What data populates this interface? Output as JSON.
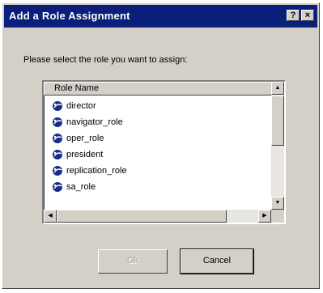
{
  "dialog": {
    "title": "Add a Role Assignment",
    "help_glyph": "?",
    "close_glyph": "×",
    "prompt": "Please select the role you want to assign:"
  },
  "list": {
    "column_header": "Role Name",
    "roles": [
      "director",
      "navigator_role",
      "oper_role",
      "president",
      "replication_role",
      "sa_role"
    ]
  },
  "buttons": {
    "ok_label": "Ok",
    "cancel_label": "Cancel"
  },
  "colors": {
    "titlebar": "#0a1f7a",
    "face": "#d4d0c8",
    "role_icon": "#1a2a8a"
  },
  "icons": {
    "role": "role-icon",
    "help": "help-icon",
    "close": "close-icon"
  }
}
